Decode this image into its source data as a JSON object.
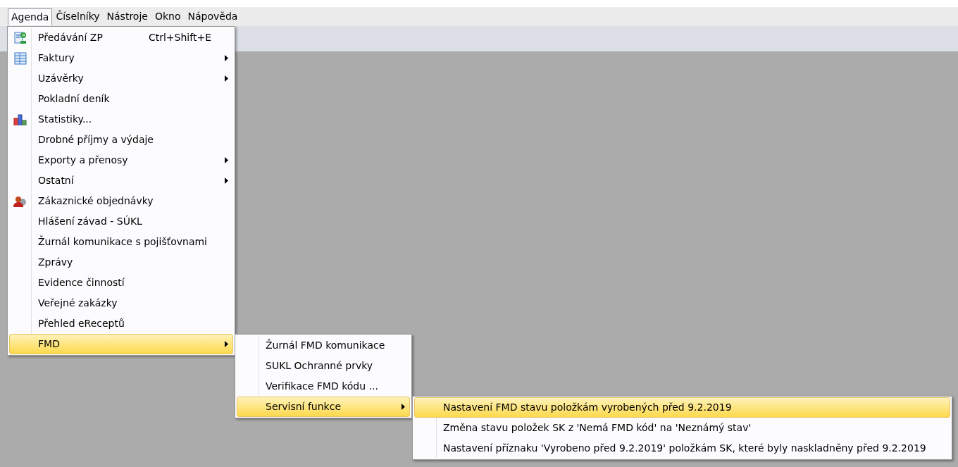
{
  "menu_bar": [
    {
      "label": "Agenda",
      "selected": true
    },
    {
      "label": "Číselníky",
      "selected": false
    },
    {
      "label": "Nástroje",
      "selected": false
    },
    {
      "label": "Okno",
      "selected": false
    },
    {
      "label": "Nápověda",
      "selected": false
    }
  ],
  "menus": [
    {
      "items": [
        {
          "label": "Předávání ZP",
          "shortcut": "Ctrl+Shift+E",
          "kind": "import",
          "submenu": false,
          "selected": false
        },
        {
          "label": "Faktury",
          "kind": "table",
          "submenu": true,
          "selected": false
        },
        {
          "label": "Uzávěrky",
          "submenu": true,
          "selected": false
        },
        {
          "label": "Pokladní deník",
          "submenu": false,
          "selected": false
        },
        {
          "label": "Statistiky...",
          "kind": "chart",
          "submenu": false,
          "selected": false
        },
        {
          "label": "Drobné příjmy a výdaje",
          "submenu": false,
          "selected": false
        },
        {
          "label": "Exporty a přenosy",
          "submenu": true,
          "selected": false
        },
        {
          "label": "Ostatní",
          "submenu": true,
          "selected": false
        },
        {
          "label": "Zákaznické objednávky",
          "kind": "person",
          "submenu": false,
          "selected": false
        },
        {
          "label": "Hlášení závad - SÚKL",
          "submenu": false,
          "selected": false
        },
        {
          "label": "Žurnál komunikace s pojišťovnami",
          "submenu": false,
          "selected": false
        },
        {
          "label": "Zprávy",
          "submenu": false,
          "selected": false
        },
        {
          "label": "Evidence činností",
          "submenu": false,
          "selected": false
        },
        {
          "label": "Veřejné zakázky",
          "submenu": false,
          "selected": false
        },
        {
          "label": "Přehled eReceptů",
          "submenu": false,
          "selected": false
        },
        {
          "label": "FMD",
          "submenu": true,
          "selected": true
        }
      ]
    },
    {
      "items": [
        {
          "label": "Žurnál FMD komunikace",
          "submenu": false,
          "selected": false
        },
        {
          "label": "SUKL Ochranné prvky",
          "submenu": false,
          "selected": false
        },
        {
          "label": "Verifikace FMD kódu ...",
          "submenu": false,
          "selected": false
        },
        {
          "label": "Servisní funkce",
          "submenu": true,
          "selected": true
        }
      ]
    },
    {
      "items": [
        {
          "label": "Nastavení FMD stavu položkám vyrobených před 9.2.2019",
          "submenu": false,
          "selected": true
        },
        {
          "label": "Změna stavu položek SK z 'Nemá FMD kód' na 'Neznámý stav'",
          "submenu": false,
          "selected": false
        },
        {
          "label": "Nastavení příznaku 'Vyrobeno před 9.2.2019' položkám SK, které byly naskladněny před 9.2.2019",
          "submenu": false,
          "selected": false
        }
      ]
    }
  ]
}
